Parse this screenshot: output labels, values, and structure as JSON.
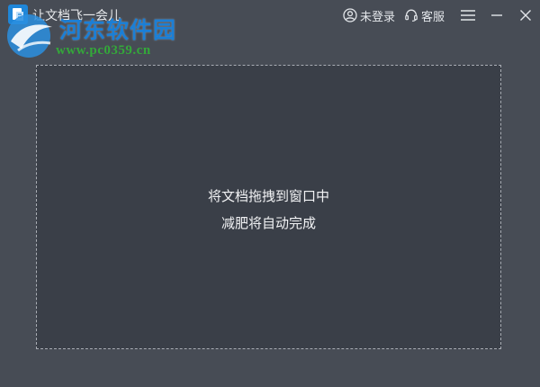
{
  "window": {
    "title": "让文档飞一会儿"
  },
  "watermark": {
    "name": "河东软件园",
    "url": "www.pc0359.cn"
  },
  "header": {
    "login_label": "未登录",
    "service_label": "客服"
  },
  "icons": {
    "app": "app-logo-icon",
    "user": "user-icon",
    "headset": "headset-icon",
    "menu": "hamburger-menu-icon",
    "minimize": "minimize-icon",
    "close": "close-icon"
  },
  "drop_zone": {
    "line1": "将文档拖拽到窗口中",
    "line2": "减肥将自动完成"
  },
  "colors": {
    "background": "#474c55",
    "drop_zone_bg": "#3a3f48",
    "watermark_blue": "#1b7fd6",
    "watermark_green": "#34a83a",
    "text": "#f2f3f5"
  }
}
